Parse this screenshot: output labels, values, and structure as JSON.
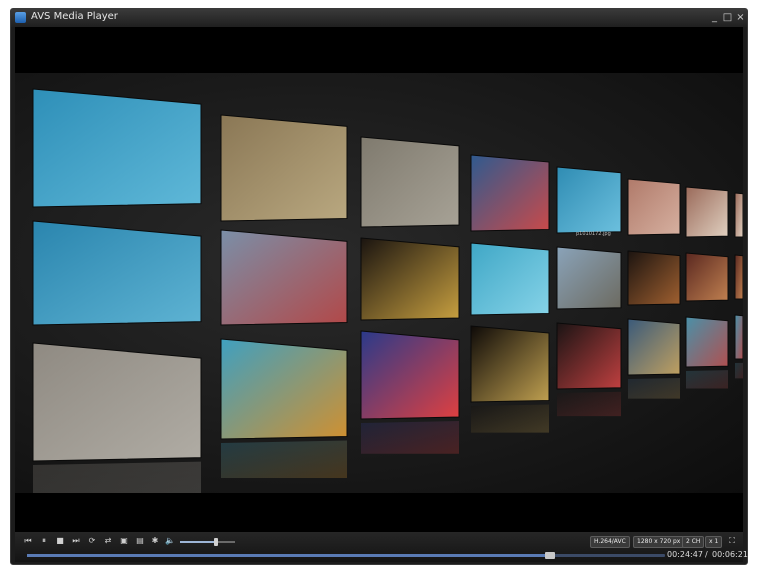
{
  "window": {
    "title": "AVS Media Player"
  },
  "title_buttons": {
    "minimize": "_",
    "maximize": "□",
    "close": "×"
  },
  "thumbnails": [
    {
      "id": "sea-1",
      "colors": [
        "#2e8fb8",
        "#5fb8d8"
      ]
    },
    {
      "id": "climbing-wall-1",
      "colors": [
        "#8a7755",
        "#b9a880"
      ]
    },
    {
      "id": "stone-panel",
      "colors": [
        "#7f7a6e",
        "#a7a296"
      ]
    },
    {
      "id": "crowd-stage",
      "colors": [
        "#2f5a8f",
        "#c94a4a"
      ]
    },
    {
      "id": "sea-2",
      "colors": [
        "#2f8cb3",
        "#6cc0de"
      ]
    },
    {
      "id": "red-floor",
      "colors": [
        "#b07a6a",
        "#d6b0a0"
      ]
    },
    {
      "id": "people-group",
      "colors": [
        "#9a6a5a",
        "#e0d0c0"
      ]
    },
    {
      "id": "deck-people",
      "colors": [
        "#7a8fa8",
        "#b24848"
      ]
    },
    {
      "id": "sea-3",
      "colors": [
        "#2a85ae",
        "#5eb3d3"
      ]
    },
    {
      "id": "night-lights",
      "colors": [
        "#1a1410",
        "#c8a040"
      ]
    },
    {
      "id": "pool-swim",
      "colors": [
        "#3fa7c6",
        "#86d3e8"
      ]
    },
    {
      "id": "harbor",
      "colors": [
        "#8aa3b9",
        "#6c6a60"
      ]
    },
    {
      "id": "dark-lamp",
      "colors": [
        "#1c1410",
        "#a06030"
      ]
    },
    {
      "id": "casino",
      "colors": [
        "#5a2820",
        "#c08050"
      ]
    },
    {
      "id": "climbing-wall-2",
      "colors": [
        "#8f8a82",
        "#b0aca4"
      ]
    },
    {
      "id": "pool-deck",
      "colors": [
        "#3fa0c0",
        "#d09030"
      ]
    },
    {
      "id": "stage-kids",
      "colors": [
        "#2a3a8a",
        "#e04040"
      ]
    },
    {
      "id": "night-stage",
      "colors": [
        "#0e0a08",
        "#c0a050"
      ]
    },
    {
      "id": "ship-deck-night",
      "colors": [
        "#1a1414",
        "#c04040"
      ]
    },
    {
      "id": "ship-railing",
      "colors": [
        "#3a5a7a",
        "#c0a060"
      ]
    },
    {
      "id": "pool-people",
      "colors": [
        "#4a90a8",
        "#b05050"
      ]
    }
  ],
  "thumb_caption": "p1010172.jpg",
  "controls": {
    "prev_icon": "⏮",
    "pause_icon": "⏸",
    "stop_icon": "■",
    "next_icon": "⏭",
    "repeat_icon": "⟳",
    "shuffle_icon": "⇄",
    "snapshot_icon": "▣",
    "playlist_icon": "▤",
    "settings_icon": "✱",
    "volume_icon": "🔈",
    "volume_level": 0.65,
    "codec": "H.264/AVC",
    "resolution": "1280 x 720 px",
    "channels": "2 CH",
    "speed": "x 1",
    "fullscreen_icon": "⛶"
  },
  "seek": {
    "progress": 0.82,
    "current_time": "00:24:47",
    "separator": "/",
    "total_time": "00:06:21"
  }
}
